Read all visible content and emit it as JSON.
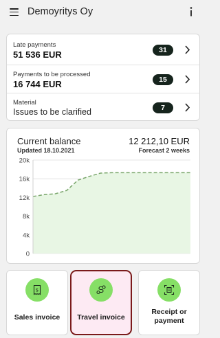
{
  "header": {
    "title": "Demoyritys Oy",
    "menu_icon": "hamburger-menu-icon",
    "info_icon": "info-icon"
  },
  "summary": {
    "rows": [
      {
        "label": "Late payments",
        "value": "51 536 EUR",
        "count": "31"
      },
      {
        "label": "Payments to be processed",
        "value": "16 744 EUR",
        "count": "15"
      },
      {
        "label": "Material",
        "value": "Issues to be clarified",
        "count": "7"
      }
    ]
  },
  "balance": {
    "title": "Current balance",
    "amount": "12 212,10 EUR",
    "updated": "Updated 18.10.2021",
    "forecast": "Forecast 2 weeks"
  },
  "chart_data": {
    "type": "area",
    "title": "",
    "xlabel": "",
    "ylabel": "",
    "ylim": [
      0,
      20000
    ],
    "y_ticks": [
      "0",
      "4k",
      "8k",
      "12k",
      "16k",
      "20k"
    ],
    "grid": true,
    "line_style": "dashed",
    "colors": {
      "line": "#78a56a",
      "fill": "#e8f6e4",
      "grid": "#e4e4e4"
    },
    "series": [
      {
        "values": [
          12200,
          12600,
          12800,
          13500,
          15700,
          16500,
          17200,
          17300,
          17300,
          17300,
          17300,
          17300,
          17300,
          17300,
          17300
        ]
      }
    ]
  },
  "actions": [
    {
      "label": "Sales invoice",
      "icon": "sales-invoice-icon"
    },
    {
      "label": "Travel invoice",
      "icon": "travel-route-icon"
    },
    {
      "label": "Receipt or payment",
      "icon": "receipt-scan-icon"
    }
  ],
  "colors": {
    "accent_green": "#86df66",
    "badge_dark": "#16241d",
    "selected_border": "#7a1a1a",
    "selected_bg": "#fdeaf3"
  }
}
